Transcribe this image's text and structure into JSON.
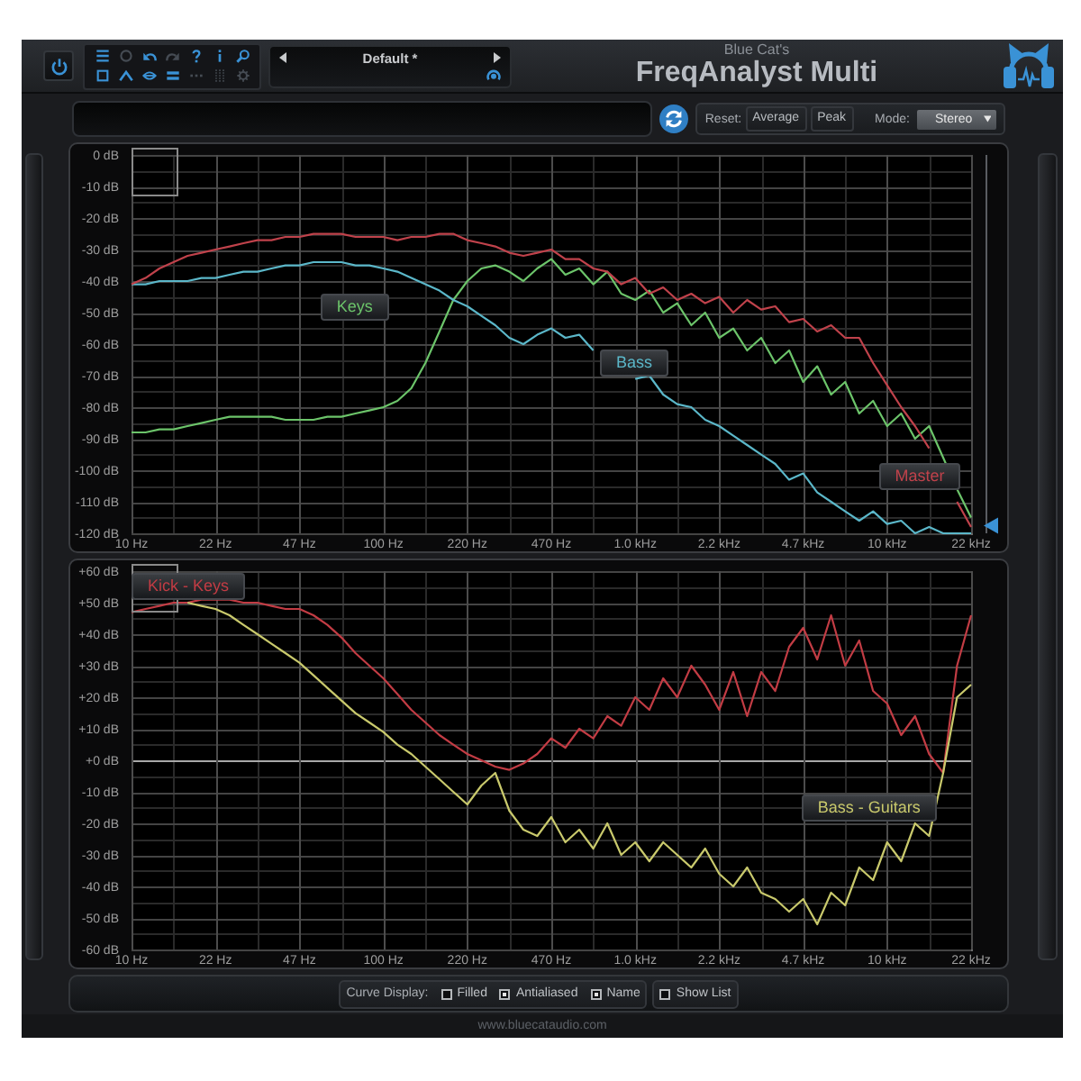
{
  "header": {
    "power": {
      "on": true
    },
    "toolbar": [
      {
        "kind": "menu",
        "disabled": false
      },
      {
        "kind": "circle",
        "disabled": true
      },
      {
        "kind": "undo",
        "disabled": false
      },
      {
        "kind": "redo",
        "disabled": true
      },
      {
        "kind": "help",
        "disabled": false
      },
      {
        "kind": "info",
        "disabled": false
      },
      {
        "kind": "search",
        "disabled": false
      },
      {
        "kind": "square",
        "disabled": false
      },
      {
        "kind": "chevron",
        "disabled": false
      },
      {
        "kind": "eye",
        "disabled": false
      },
      {
        "kind": "bars",
        "disabled": false
      },
      {
        "kind": "dots",
        "disabled": true
      },
      {
        "kind": "columns",
        "disabled": true
      },
      {
        "kind": "gear",
        "disabled": true
      }
    ],
    "preset": {
      "name": "Default *"
    },
    "brand": "Blue Cat's",
    "title": "FreqAnalyst Multi"
  },
  "controls": {
    "reset_label": "Reset:",
    "buttons": [
      "Average",
      "Peak"
    ],
    "mode": {
      "label": "Mode:",
      "value": "Stereo"
    }
  },
  "charts": [
    {
      "chart_data": {
        "type": "line",
        "grid": true,
        "categories": [
          "10 Hz",
          null,
          null,
          null,
          null,
          null,
          "22 Hz",
          null,
          null,
          null,
          null,
          null,
          "47 Hz",
          null,
          null,
          null,
          null,
          null,
          "100 Hz",
          null,
          null,
          null,
          null,
          null,
          "220 Hz",
          null,
          null,
          null,
          null,
          null,
          "470 Hz",
          null,
          null,
          null,
          null,
          null,
          "1.0 kHz",
          null,
          null,
          null,
          null,
          null,
          "2.2 kHz",
          null,
          null,
          null,
          null,
          null,
          "4.7 kHz",
          null,
          null,
          null,
          null,
          null,
          "10 kHz",
          null,
          null,
          null,
          null,
          null,
          "22 kHz"
        ],
        "series": [
          {
            "color": "#6cc46a",
            "values": [
              -88,
              -88,
              -87,
              -87,
              -86,
              -85,
              -84,
              -83,
              -83,
              -83,
              -83,
              -84,
              -84,
              -84,
              -83,
              -83,
              -82,
              -81,
              -80,
              -78,
              -74,
              -66,
              -56,
              -46,
              -40,
              -36,
              -35,
              -37,
              -40,
              -36,
              -33,
              -38,
              -36,
              -41,
              -37,
              -44,
              -46,
              -43,
              -50,
              -47,
              -54,
              -50,
              -58,
              -55,
              -62,
              -58,
              -66,
              -62,
              -72,
              -67,
              -76,
              -72,
              -82,
              -78,
              -86,
              -82,
              -90,
              -86,
              -96,
              -106,
              -115
            ]
          },
          {
            "color": "#5bb7c9",
            "values": [
              -41,
              -41,
              -40,
              -40,
              -40,
              -39,
              -39,
              -38,
              -37,
              -37,
              -36,
              -35,
              -35,
              -34,
              -34,
              -34,
              -35,
              -35,
              -36,
              -37,
              -39,
              -41,
              -43,
              -46,
              -48,
              -51,
              -54,
              -58,
              -60,
              -57,
              -55,
              -58,
              -57,
              -62,
              null,
              null,
              -71,
              -70,
              -76,
              -79,
              -80,
              -84,
              -86,
              -89,
              -92,
              -95,
              -98,
              -103,
              -101,
              -107,
              -110,
              -113,
              -116,
              -113,
              -117,
              -116,
              -120,
              -118,
              -120,
              -120,
              -120
            ]
          },
          {
            "color": "#c0424b",
            "values": [
              -41,
              -39,
              -36,
              -34,
              -32,
              -31,
              -30,
              -29,
              -28,
              -27,
              -27,
              -26,
              -26,
              -25,
              -25,
              -25,
              -26,
              -26,
              -26,
              -27,
              -26,
              -26,
              -25,
              -25,
              -27,
              -28,
              -29,
              -31,
              -32,
              -31,
              -30,
              -33,
              -33,
              -36,
              -37,
              -41,
              -39,
              -44,
              -42,
              -46,
              -44,
              -47,
              -45,
              -50,
              -46,
              -49,
              -48,
              -53,
              -52,
              -56,
              -54,
              -58,
              -58,
              -66,
              -73,
              -80,
              -86,
              -93,
              null,
              -110,
              -118
            ]
          }
        ],
        "ylim": [
          -120,
          0
        ],
        "yticks": [
          {
            "value": 0,
            "label": "0 dB"
          },
          {
            "value": -10,
            "label": "-10 dB"
          },
          {
            "value": -20,
            "label": "-20 dB"
          },
          {
            "value": -30,
            "label": "-30 dB"
          },
          {
            "value": -40,
            "label": "-40 dB"
          },
          {
            "value": -50,
            "label": "-50 dB"
          },
          {
            "value": -60,
            "label": "-60 dB"
          },
          {
            "value": -70,
            "label": "-70 dB"
          },
          {
            "value": -80,
            "label": "-80 dB"
          },
          {
            "value": -90,
            "label": "-90 dB"
          },
          {
            "value": -100,
            "label": "-100 dB"
          },
          {
            "value": -110,
            "label": "-110 dB"
          },
          {
            "value": -120,
            "label": "-120 dB"
          }
        ],
        "annotations": [
          "Keys",
          "Bass",
          "Master"
        ]
      },
      "slider": {
        "level": 0.02
      }
    },
    {
      "chart_data": {
        "type": "line",
        "grid": true,
        "categories": [
          "10 Hz",
          null,
          null,
          null,
          null,
          null,
          "22 Hz",
          null,
          null,
          null,
          null,
          null,
          "47 Hz",
          null,
          null,
          null,
          null,
          null,
          "100 Hz",
          null,
          null,
          null,
          null,
          null,
          "220 Hz",
          null,
          null,
          null,
          null,
          null,
          "470 Hz",
          null,
          null,
          null,
          null,
          null,
          "1.0 kHz",
          null,
          null,
          null,
          null,
          null,
          "2.2 kHz",
          null,
          null,
          null,
          null,
          null,
          "4.7 kHz",
          null,
          null,
          null,
          null,
          null,
          "10 kHz",
          null,
          null,
          null,
          null,
          null,
          "22 kHz"
        ],
        "series": [
          {
            "color": "#c23c44",
            "values": [
              47,
              48,
              49,
              50,
              50,
              51,
              51,
              51,
              50,
              50,
              49,
              48,
              48,
              46,
              43,
              39,
              34,
              30,
              26,
              21,
              16,
              12,
              8,
              5,
              2,
              0,
              -2,
              -3,
              -1,
              2,
              7,
              4,
              10,
              7,
              14,
              11,
              20,
              16,
              26,
              20,
              30,
              24,
              16,
              28,
              14,
              28,
              22,
              36,
              42,
              32,
              46,
              30,
              38,
              22,
              18,
              8,
              14,
              2,
              -4,
              30,
              46
            ]
          },
          {
            "color": "#c9c96c",
            "values": [
              null,
              null,
              null,
              null,
              50,
              49,
              48,
              46,
              43,
              40,
              37,
              34,
              31,
              27,
              23,
              19,
              15,
              12,
              9,
              5,
              2,
              -2,
              -6,
              -10,
              -14,
              -8,
              -4,
              -16,
              -22,
              -24,
              -18,
              -26,
              -22,
              -28,
              -20,
              -30,
              -26,
              -32,
              -26,
              -30,
              -34,
              -28,
              -36,
              -40,
              -34,
              -42,
              -44,
              -48,
              -44,
              -52,
              -42,
              -46,
              -34,
              -38,
              -26,
              -32,
              -20,
              -24,
              -4,
              20,
              24
            ]
          }
        ],
        "ylim": [
          -60,
          60
        ],
        "yticks": [
          {
            "value": 60,
            "label": "+60 dB"
          },
          {
            "value": 50,
            "label": "+50 dB"
          },
          {
            "value": 40,
            "label": "+40 dB"
          },
          {
            "value": 30,
            "label": "+30 dB"
          },
          {
            "value": 20,
            "label": "+20 dB"
          },
          {
            "value": 10,
            "label": "+10 dB"
          },
          {
            "value": 0,
            "label": "+0 dB"
          },
          {
            "value": -10,
            "label": "-10 dB"
          },
          {
            "value": -20,
            "label": "-20 dB"
          },
          {
            "value": -30,
            "label": "-30 dB"
          },
          {
            "value": -40,
            "label": "-40 dB"
          },
          {
            "value": -50,
            "label": "-50 dB"
          },
          {
            "value": -60,
            "label": "-60 dB"
          }
        ],
        "annotations": [
          "Kick - Keys",
          "Bass - Guitars"
        ]
      }
    }
  ],
  "curve_display": {
    "label": "Curve Display:",
    "options": [
      {
        "label": "Filled",
        "checked": false
      },
      {
        "label": "Antialiased",
        "checked": true
      },
      {
        "label": "Name",
        "checked": true
      }
    ],
    "show_list": {
      "label": "Show List",
      "checked": false
    }
  },
  "footer": "www.bluecataudio.com"
}
